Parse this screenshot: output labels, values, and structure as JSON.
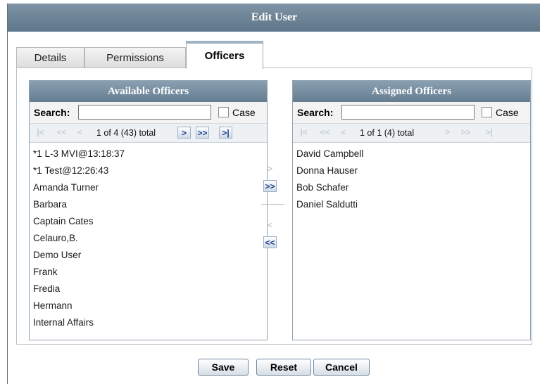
{
  "dialog": {
    "title": "Edit User"
  },
  "tabs": [
    {
      "label": "Details"
    },
    {
      "label": "Permissions"
    },
    {
      "label": "Officers"
    }
  ],
  "available": {
    "title": "Available Officers",
    "search_label": "Search:",
    "search_value": "",
    "case_label": "Case",
    "case_checked": false,
    "pager_text": "1 of 4 (43) total",
    "items": [
      "*1 L-3 MVI@13:18:37",
      "*1 Test@12:26:43",
      "Amanda Turner",
      "Barbara",
      "Captain Cates",
      "Celauro,B.",
      "Demo User",
      "Frank",
      "Fredia",
      "Hermann",
      "Internal Affairs"
    ]
  },
  "assigned": {
    "title": "Assigned Officers",
    "search_label": "Search:",
    "search_value": "",
    "case_label": "Case",
    "case_checked": false,
    "pager_text": "1 of 1 (4) total",
    "items": [
      "David Campbell",
      "Donna Hauser",
      "Bob Schafer",
      "Daniel Saldutti"
    ]
  },
  "icons": {
    "first": "|<",
    "prev_page": "<<",
    "prev": "<",
    "next": ">",
    "next_page": ">>",
    "last": ">|",
    "move_one_right": ">",
    "move_all_right": ">>",
    "move_one_left": "<",
    "move_all_left": "<<"
  },
  "footer": {
    "save_label": "Save",
    "reset_label": "Reset",
    "cancel_label": "Cancel"
  },
  "colors": {
    "title_bar": "#6a8093",
    "nav_enabled": "#1a3e8c",
    "nav_disabled": "#c4ccd4"
  }
}
